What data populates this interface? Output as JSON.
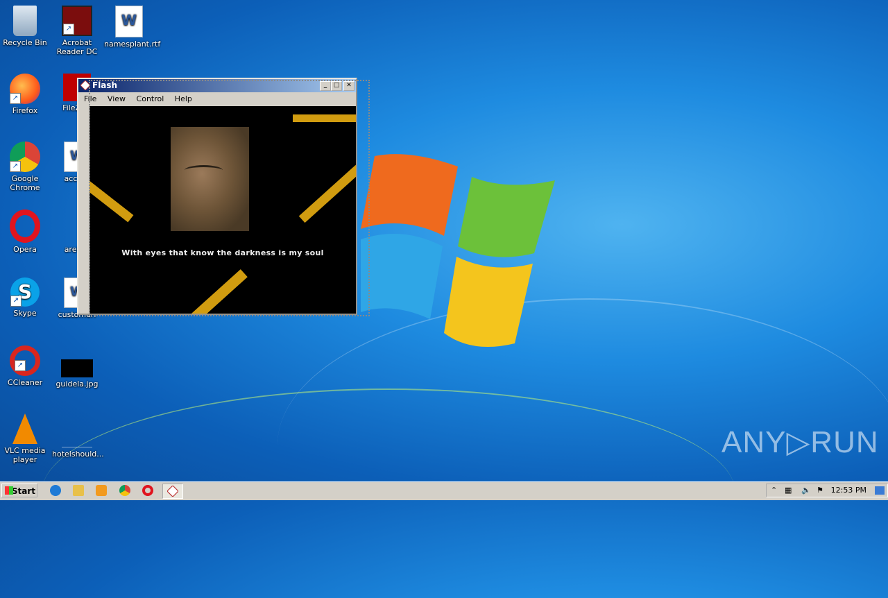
{
  "desktop": {
    "icons": [
      {
        "name": "Recycle Bin"
      },
      {
        "name": "Acrobat Reader DC"
      },
      {
        "name": "namesplant.rtf"
      },
      {
        "name": "Firefox"
      },
      {
        "name": "FileZilla"
      },
      {
        "name": "Google Chrome"
      },
      {
        "name": "accept"
      },
      {
        "name": "Opera"
      },
      {
        "name": "areinsi"
      },
      {
        "name": "Skype"
      },
      {
        "name": "customeri"
      },
      {
        "name": "CCleaner"
      },
      {
        "name": "guidela.jpg"
      },
      {
        "name": "VLC media player"
      },
      {
        "name": "hotelshould..."
      }
    ]
  },
  "flash_window": {
    "title": "Flash",
    "menu": [
      "File",
      "View",
      "Control",
      "Help"
    ],
    "lyric": "With eyes that know the darkness is my soul"
  },
  "taskbar": {
    "start_label": "Start",
    "clock": "12:53 PM"
  },
  "watermark": "ANY▷RUN",
  "colors": {
    "accent_bar": "#d19c10",
    "titlebar": "#0a246a"
  }
}
